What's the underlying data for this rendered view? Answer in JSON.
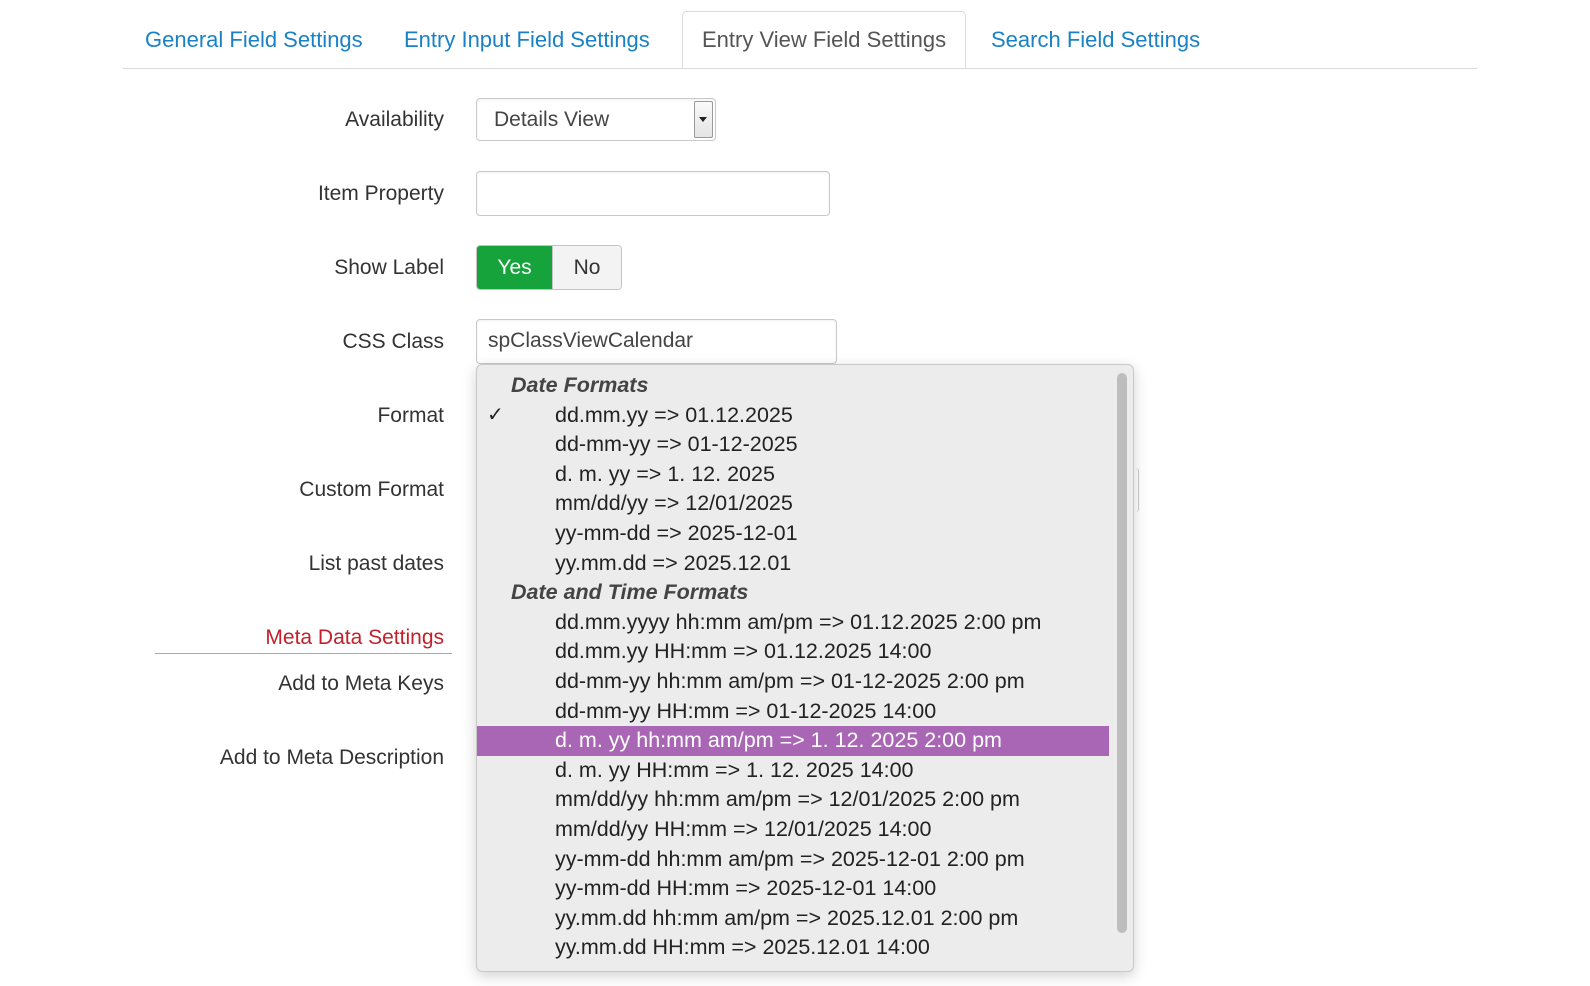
{
  "tabs": [
    {
      "label": "General Field Settings"
    },
    {
      "label": "Entry Input Field Settings"
    },
    {
      "label": "Entry View Field Settings"
    },
    {
      "label": "Search Field Settings"
    }
  ],
  "form": {
    "availability": {
      "label": "Availability",
      "value": "Details View"
    },
    "item_property": {
      "label": "Item Property",
      "value": ""
    },
    "show_label": {
      "label": "Show Label",
      "yes": "Yes",
      "no": "No",
      "selected": "Yes"
    },
    "css_class": {
      "label": "CSS Class",
      "value": "spClassViewCalendar"
    },
    "format": {
      "label": "Format"
    },
    "custom_format": {
      "label": "Custom Format"
    },
    "list_past_dates": {
      "label": "List past dates"
    },
    "meta_section": {
      "label": "Meta Data Settings"
    },
    "meta_keys": {
      "label": "Add to Meta Keys"
    },
    "meta_description": {
      "label": "Add to Meta Description"
    }
  },
  "format_dropdown": {
    "check_glyph": "✓",
    "groups": [
      {
        "label": "Date Formats",
        "items": [
          "dd.mm.yy => 01.12.2025",
          "dd-mm-yy => 01-12-2025",
          "d. m. yy => 1. 12. 2025",
          "mm/dd/yy => 12/01/2025",
          "yy-mm-dd => 2025-12-01",
          "yy.mm.dd => 2025.12.01"
        ]
      },
      {
        "label": "Date and Time Formats",
        "items": [
          "dd.mm.yyyy hh:mm am/pm => 01.12.2025 2:00 pm",
          "dd.mm.yy HH:mm => 01.12.2025 14:00",
          "dd-mm-yy hh:mm am/pm => 01-12-2025 2:00 pm",
          "dd-mm-yy HH:mm => 01-12-2025 14:00",
          "d. m. yy hh:mm am/pm => 1. 12. 2025 2:00 pm",
          "d. m. yy HH:mm => 1. 12. 2025 14:00",
          "mm/dd/yy hh:mm am/pm => 12/01/2025 2:00 pm",
          "mm/dd/yy HH:mm => 12/01/2025 14:00",
          "yy-mm-dd hh:mm am/pm => 2025-12-01 2:00 pm",
          "yy-mm-dd HH:mm => 2025-12-01 14:00",
          "yy.mm.dd hh:mm am/pm => 2025.12.01 2:00 pm",
          "yy.mm.dd HH:mm => 2025.12.01 14:00"
        ]
      }
    ],
    "checked_item": "dd.mm.yy => 01.12.2025",
    "highlighted_item": "d. m. yy hh:mm am/pm => 1. 12. 2025 2:00 pm",
    "highlight_color": "#a966b4"
  },
  "colors": {
    "tab_link": "#1a82c4",
    "toggle_yes": "#17a33c",
    "meta_heading": "#c0212b"
  }
}
